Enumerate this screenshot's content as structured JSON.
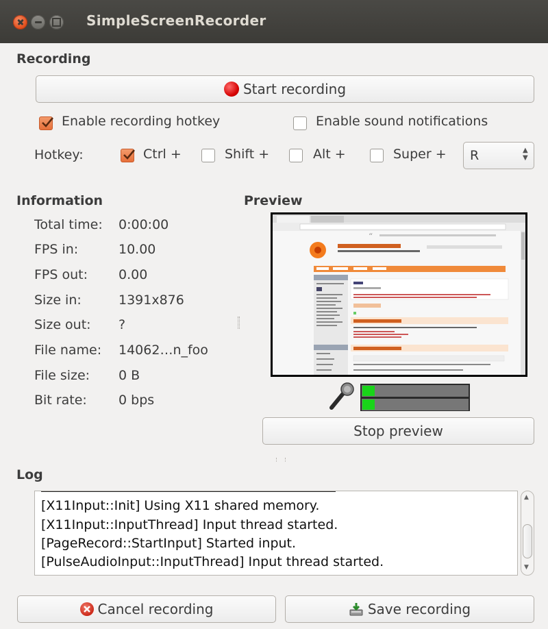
{
  "window": {
    "title": "SimpleScreenRecorder"
  },
  "recording": {
    "section_label": "Recording",
    "start_label": "Start recording",
    "enable_hotkey_label": "Enable recording hotkey",
    "enable_hotkey_checked": true,
    "enable_sound_label": "Enable sound notifications",
    "enable_sound_checked": false,
    "hotkey_label": "Hotkey:",
    "ctrl_label": "Ctrl +",
    "ctrl_checked": true,
    "shift_label": "Shift +",
    "shift_checked": false,
    "alt_label": "Alt +",
    "alt_checked": false,
    "super_label": "Super +",
    "super_checked": false,
    "key_value": "R"
  },
  "information": {
    "section_label": "Information",
    "rows": [
      {
        "label": "Total time:",
        "value": "0:00:00"
      },
      {
        "label": "FPS in:",
        "value": "10.00"
      },
      {
        "label": "FPS out:",
        "value": "0.00"
      },
      {
        "label": "Size in:",
        "value": "1391x876"
      },
      {
        "label": "Size out:",
        "value": "?"
      },
      {
        "label": "File name:",
        "value": "14062…n_foo"
      },
      {
        "label": "File size:",
        "value": "0 B"
      },
      {
        "label": "Bit rate:",
        "value": "0 bps"
      }
    ]
  },
  "preview": {
    "section_label": "Preview",
    "stop_label": "Stop preview",
    "audio_levels": [
      0.12,
      0.12
    ]
  },
  "log": {
    "section_label": "Log",
    "lines": [
      "[X11Input::Init] Using X11 shared memory.",
      "[X11Input::InputThread] Input thread started.",
      "[PageRecord::StartInput] Started input.",
      "[PulseAudioInput::InputThread] Input thread started."
    ]
  },
  "footer": {
    "cancel_label": "Cancel recording",
    "save_label": "Save recording"
  },
  "colors": {
    "titlebar": "#3c3b37",
    "accent": "#e7703a",
    "meter": "#19d419"
  }
}
